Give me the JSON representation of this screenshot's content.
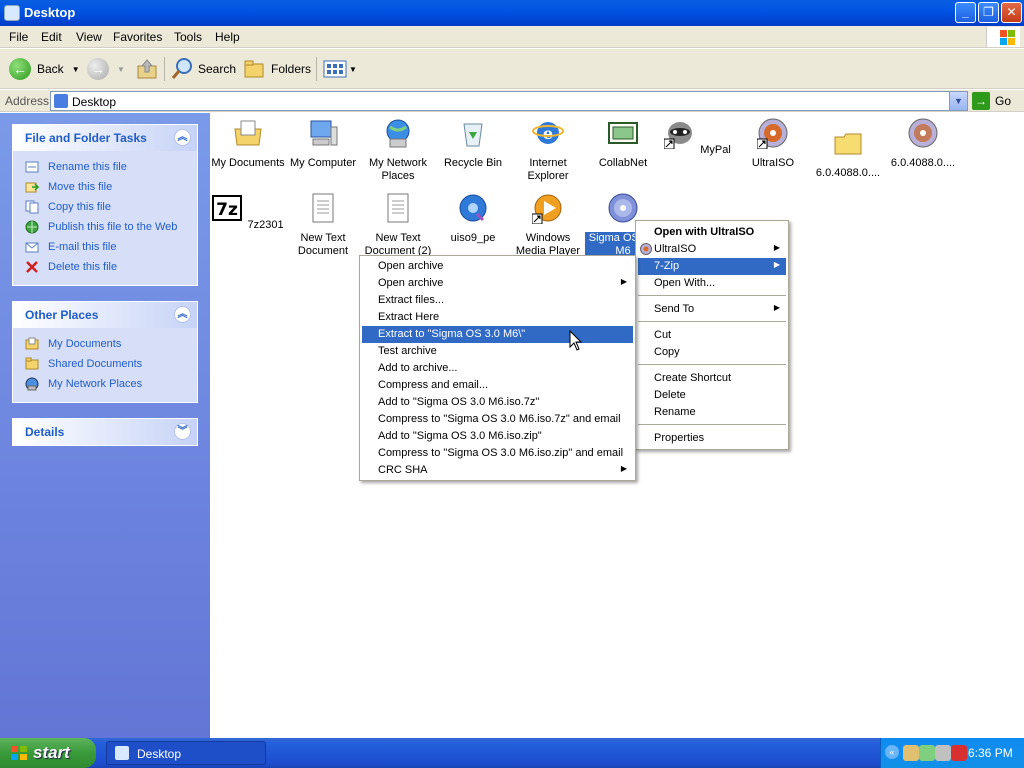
{
  "window": {
    "title": "Desktop"
  },
  "menubar": [
    "File",
    "Edit",
    "View",
    "Favorites",
    "Tools",
    "Help"
  ],
  "toolbar": {
    "back": "Back",
    "search": "Search",
    "folders": "Folders"
  },
  "address": {
    "label": "Address",
    "value": "Desktop",
    "go": "Go"
  },
  "tasks": {
    "file_folder": {
      "title": "File and Folder Tasks",
      "items": [
        "Rename this file",
        "Move this file",
        "Copy this file",
        "Publish this file to the Web",
        "E-mail this file",
        "Delete this file"
      ]
    },
    "other_places": {
      "title": "Other Places",
      "items": [
        "My Documents",
        "Shared Documents",
        "My Network Places"
      ]
    },
    "details": {
      "title": "Details"
    }
  },
  "desktop_icons": [
    {
      "label": "My Documents",
      "icon": "my-documents-icon"
    },
    {
      "label": "My Computer",
      "icon": "my-computer-icon"
    },
    {
      "label": "My Network Places",
      "icon": "network-places-icon"
    },
    {
      "label": "Recycle Bin",
      "icon": "recycle-bin-icon"
    },
    {
      "label": "Internet Explorer",
      "icon": "internet-explorer-icon"
    },
    {
      "label": "CollabNet",
      "icon": "collabnet-icon"
    },
    {
      "label": "MyPal",
      "icon": "mypal-icon"
    },
    {
      "label": "UltraISO",
      "icon": "ultraiso-icon"
    },
    {
      "label": "6.0.4088.0....",
      "icon": "folder-icon"
    },
    {
      "label": "6.0.4088.0....",
      "icon": "disc-image-icon"
    },
    {
      "label": "7z2301",
      "icon": "7zip-icon"
    },
    {
      "label": "New Text Document",
      "icon": "text-document-icon"
    },
    {
      "label": "New Text Document (2)",
      "icon": "text-document-icon"
    },
    {
      "label": "uiso9_pe",
      "icon": "uiso-installer-icon"
    },
    {
      "label": "Windows Media Player",
      "icon": "media-player-icon"
    },
    {
      "label": "Sigma OS 3.0 M6",
      "icon": "disc-image-icon"
    }
  ],
  "context_menu": {
    "items": [
      "Open with UltraISO",
      "UltraISO",
      "7-Zip",
      "Open With...",
      "Send To",
      "Cut",
      "Copy",
      "Create Shortcut",
      "Delete",
      "Rename",
      "Properties"
    ]
  },
  "zip_menu": {
    "items": [
      "Open archive",
      "Open archive",
      "Extract files...",
      "Extract Here",
      "Extract to \"Sigma OS 3.0 M6\\\"",
      "Test archive",
      "Add to archive...",
      "Compress and email...",
      "Add to \"Sigma OS 3.0 M6.iso.7z\"",
      "Compress to \"Sigma OS 3.0 M6.iso.7z\" and email",
      "Add to \"Sigma OS 3.0 M6.iso.zip\"",
      "Compress to \"Sigma OS 3.0 M6.iso.zip\" and email",
      "CRC SHA"
    ]
  },
  "taskbar": {
    "start": "start",
    "task": "Desktop",
    "clock": "6:36 PM"
  },
  "colors": {
    "accent": "#316ac5",
    "titlebar": "#0054e3",
    "taskpane": "#6375d6"
  }
}
